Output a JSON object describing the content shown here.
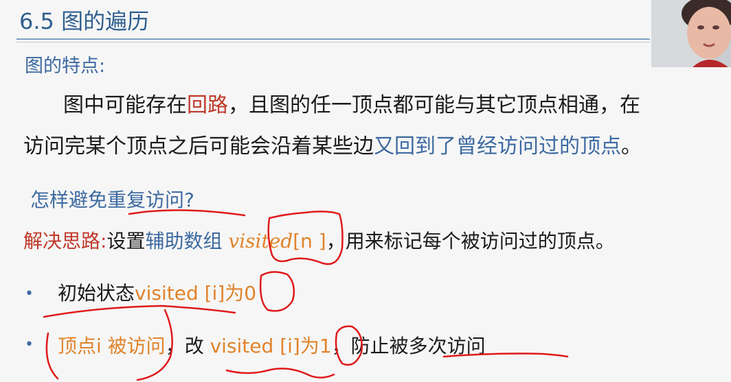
{
  "title": "6.5 图的遍历",
  "feature_heading": "图的特点:",
  "para": {
    "p1_a": "图中可能存在",
    "p1_red": "回路",
    "p1_b": "，且图的任一顶点都可能与其它顶点相通，在",
    "p2_a": "访问完某个顶点之后可能会沿着某些边",
    "p2_blue": "又回到了曾经访问过的顶点",
    "p2_end": "。"
  },
  "question": "怎样避免重复访问?",
  "solution": {
    "label": "解决思路:",
    "a": "设置",
    "aux": "辅助数组",
    "visited": "visited",
    "index": "[n ]",
    "b": "，用来标记每个被访问过的顶点。"
  },
  "bullets": {
    "mark": "•",
    "item1_a": "初始状态",
    "item1_b": "visited [i]为0",
    "item2_a": "顶点i 被访问",
    "item2_b": "，改 ",
    "item2_c": "visited [i]为1",
    "item2_d": "，防止被多次访问"
  },
  "colors": {
    "accent_blue": "#3d6aa0",
    "highlight_red": "#c0392b",
    "highlight_orange": "#e0832a",
    "ink_red": "#e0191a"
  }
}
